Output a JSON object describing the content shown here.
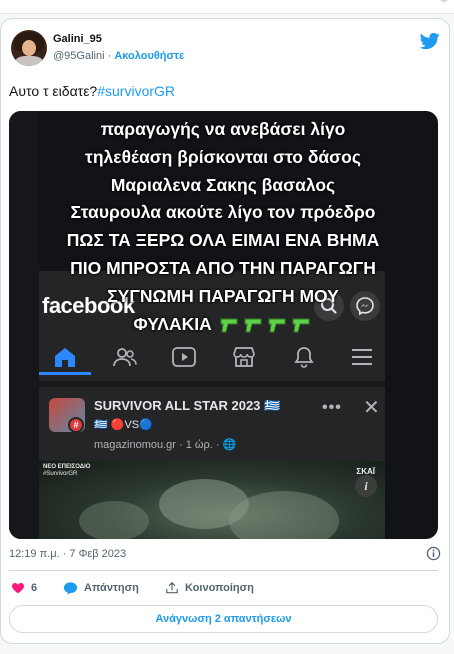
{
  "tweet": {
    "display_name": "Galini_95",
    "handle": "@95Galini",
    "separator": " · ",
    "follow_label": "Ακολουθήστε",
    "text_prefix": "Αυτο τ ειδατε?",
    "hashtag": "#survivorGR",
    "timestamp": "12:19 π.μ. · 7 Φεβ 2023",
    "like_count": "6",
    "reply_label": "Απάντηση",
    "share_label": "Κοινοποίηση",
    "read_replies_label": "Ανάγνωση 2 απαντήσεων",
    "brand_color": "#1d9bf0",
    "like_color": "#f91880"
  },
  "media": {
    "overlay_lines": [
      "παραγωγής να ανεβάσει λίγο",
      "τηλεθέαση βρίσκονται στο δάσος",
      "Μαριαλενα Σακης βασαλος",
      "Σταυρουλα ακούτε λίγο τον πρόεδρο",
      "ΠΩΣ ΤΑ ΞΕΡΩ ΟΛΑ ΕΙΜΑΙ ΕΝΑ ΒΗΜΑ",
      "ΠΙΟ ΜΠΡΟΣΤΑ ΑΠΟ ΤΗΝ ΠΑΡΑΓΩΓΗ",
      "ΣΥΓΝΩΜΗ ΠΑΡΑΓΩΓΗ ΜΟΥ",
      "ΦΥΛΑΚΙΑ"
    ],
    "facebook_logo": "facebook",
    "post_title": "SURVIVOR ALL STAR 2023 🇬🇷",
    "post_emoji_line": "🇬🇷 🔴VS🔵",
    "post_source": "magazinomou.gr · 1 ώρ. · 🌐",
    "video_label_a": "ΝΕΟ ΕΠΕΙΣΟΔΙΟ",
    "video_label_b": "#SurvivorGR",
    "video_channel": "ΣΚΑΪ",
    "video_info": "i"
  },
  "icons": {
    "twitter_bird": "twitter-bird-icon",
    "info": "info-circle-icon",
    "like": "heart-icon",
    "reply": "speech-bubble-icon",
    "share": "share-icon",
    "fb_nav": [
      "home-icon",
      "friends-icon",
      "video-icon",
      "marketplace-icon",
      "bell-icon",
      "menu-icon"
    ]
  }
}
